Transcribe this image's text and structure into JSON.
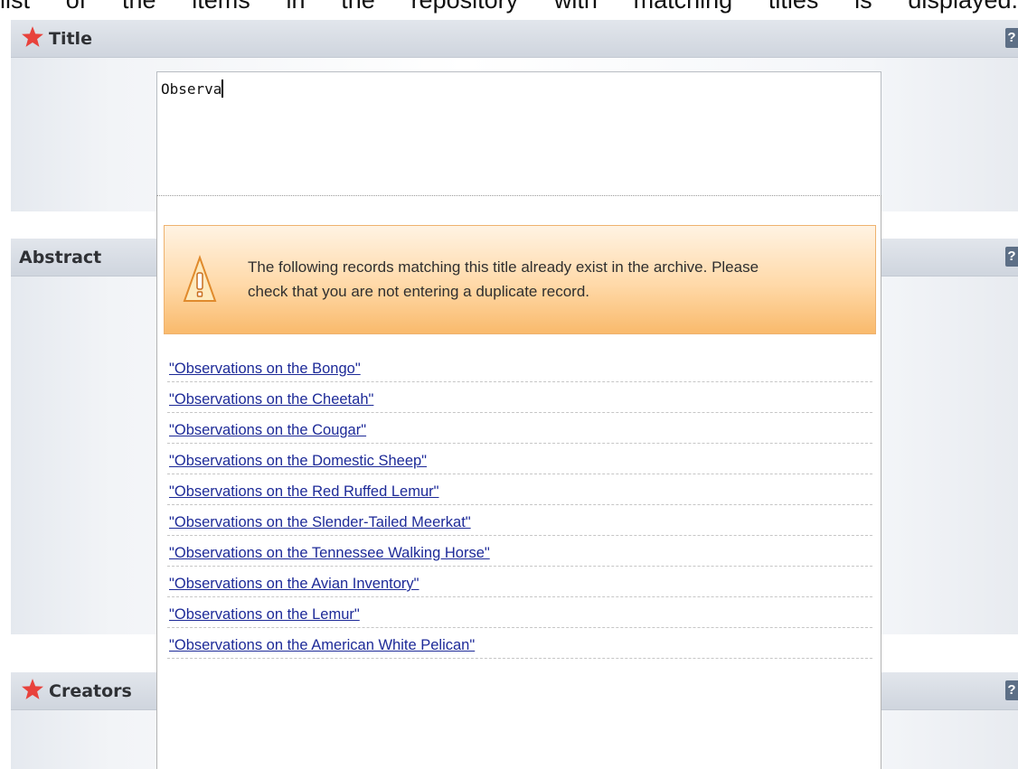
{
  "caption": "list of the items in the repository with matching titles is displayed.",
  "colors": {
    "required_star": "#e8423c",
    "header_text": "#2f3135",
    "link": "#1d2a98",
    "help_icon_bg": "#5d6f86",
    "warning_border": "#eeb26f"
  },
  "fields": {
    "title": {
      "label": "Title",
      "required": true,
      "help_icon": "help-icon",
      "help_text": "?"
    },
    "abstract": {
      "label": "Abstract",
      "required": false,
      "help_icon": "help-icon",
      "help_text": "?"
    },
    "creators": {
      "label": "Creators",
      "required": true,
      "help_icon": "help-icon",
      "help_text": "?"
    }
  },
  "title_input": {
    "value": "Observa"
  },
  "duplicate_check": {
    "icon": "warning-icon",
    "warning_line1": "The following records matching this title already exist in the archive. Please",
    "warning_line2": "check that you are not entering a duplicate record.",
    "results": [
      "\"Observations on the Bongo\"",
      "\"Observations on the Cheetah\"",
      "\"Observations on the Cougar\"",
      "\"Observations on the Domestic Sheep\"",
      "\"Observations on the Red Ruffed Lemur\"",
      "\"Observations on the Slender-Tailed Meerkat\"",
      "\"Observations on the Tennessee Walking Horse\"",
      "\"Observations on the Avian Inventory\"",
      "\"Observations on the Lemur\"",
      "\"Observations on the American White Pelican\""
    ]
  }
}
